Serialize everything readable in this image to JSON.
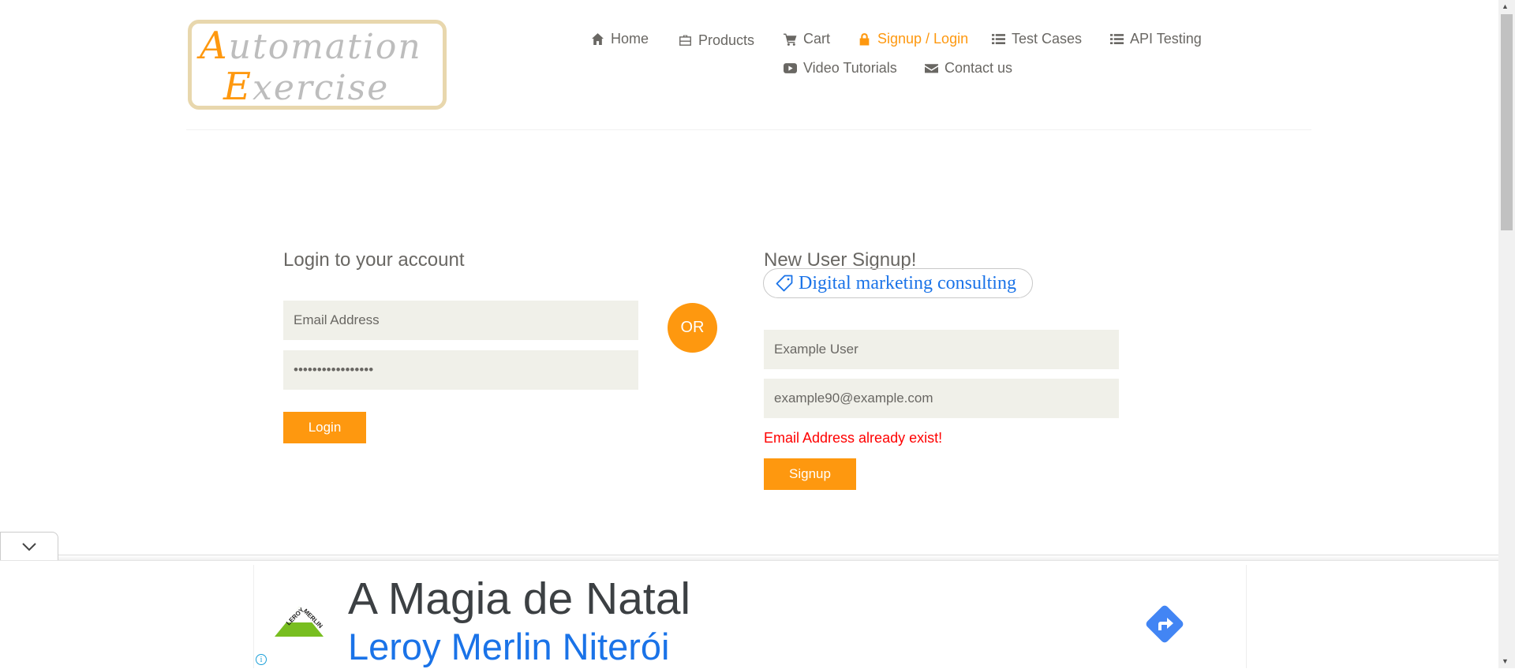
{
  "logo": {
    "line1_cap": "A",
    "line1_rest": "utomation",
    "line2_cap": "E",
    "line2_rest": "xercise"
  },
  "nav": {
    "home": "Home",
    "products": "Products",
    "cart": "Cart",
    "signup_login": "Signup / Login",
    "test_cases": "Test Cases",
    "api_testing": "API Testing",
    "video_tutorials": "Video Tutorials",
    "contact_us": "Contact us"
  },
  "login": {
    "title": "Login to your account",
    "email_placeholder": "Email Address",
    "password_value": "•••••••••••••••••",
    "button": "Login"
  },
  "or_label": "OR",
  "signup": {
    "title": "New User Signup!",
    "name_value": "Example User",
    "email_value": "example90@example.com",
    "error": "Email Address already exist!",
    "button": "Signup"
  },
  "ad_chip": {
    "label": "Digital marketing consulting",
    "icon": "tag-icon"
  },
  "bottom_ad": {
    "title": "A Magia de Natal",
    "subtitle": "Leroy Merlin Niterói",
    "logo_text": "LEROY MERLIN",
    "colors": {
      "accent": "#fe980f",
      "link": "#1a73e8",
      "ad_logo": "#78be20"
    }
  }
}
